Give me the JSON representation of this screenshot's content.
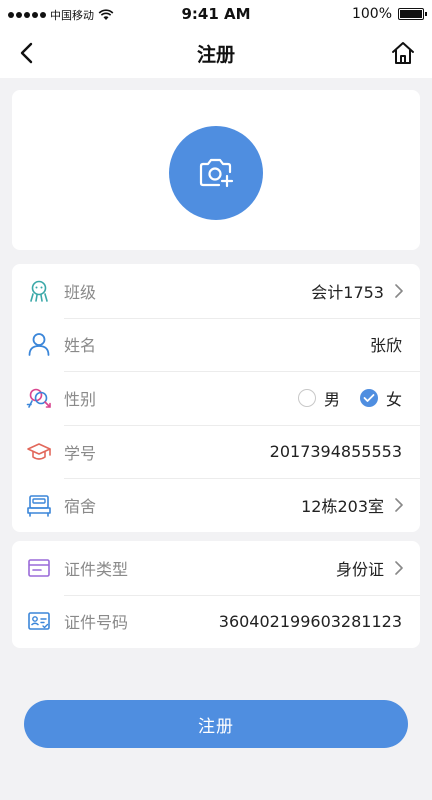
{
  "status_bar": {
    "carrier": "中国移动",
    "time": "9:41 AM",
    "battery": "100%"
  },
  "nav": {
    "title": "注册"
  },
  "form": {
    "class": {
      "label": "班级",
      "value": "会计1753"
    },
    "name": {
      "label": "姓名",
      "value": "张欣"
    },
    "gender": {
      "label": "性别",
      "options": [
        "男",
        "女"
      ],
      "selected": "女"
    },
    "student_id": {
      "label": "学号",
      "value": "2017394855553"
    },
    "dorm": {
      "label": "宿舍",
      "value": "12栋203室"
    },
    "id_type": {
      "label": "证件类型",
      "value": "身份证"
    },
    "id_number": {
      "label": "证件号码",
      "value": "360402199603281123"
    }
  },
  "submit_label": "注册",
  "colors": {
    "accent": "#4f8ee0",
    "background": "#f2f2f4",
    "label": "#8a8a8a"
  }
}
